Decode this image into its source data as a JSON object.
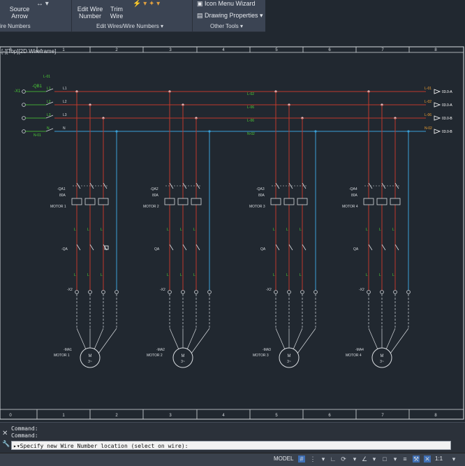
{
  "ribbon": {
    "source_arrow": "Source Arrow",
    "edit_wire_number": "Edit Wire Number",
    "trim_wire": "Trim Wire",
    "icon_menu_wizard": "Icon Menu Wizard",
    "drawing_properties": "Drawing Properties",
    "panel_wire_numbers": "ire Numbers",
    "panel_edit_wires": "Edit Wires/Wire Numbers",
    "panel_other_tools": "Other Tools"
  },
  "viewport": {
    "label": "[-][Top][2D Wireframe]"
  },
  "ruler": {
    "columns": [
      "0",
      "1",
      "2",
      "3",
      "4",
      "5",
      "6",
      "7",
      "8"
    ]
  },
  "drawing": {
    "breaker": "-QB1",
    "source_tag": "-X1",
    "feed_left": [
      "L1",
      "L2",
      "L3",
      "N"
    ],
    "feed_left_codes": [
      "L-01",
      "L-02",
      "L-03",
      "N-01"
    ],
    "bus_codes_mid": [
      "L-02",
      "L-06",
      "L-06",
      "N-02"
    ],
    "bus_outputs": [
      "L-01",
      "L-02",
      "L-06",
      "N-02"
    ],
    "bus_out_labels": [
      "03.0-A",
      "03.0-A",
      "03.0-B",
      "03.0-B"
    ],
    "motors": [
      {
        "contactor": "-QA1",
        "rating": "80A",
        "name": "MOTOR 1",
        "qa": "-QA",
        "term": "-X2",
        "motor": "-MA1"
      },
      {
        "contactor": "-QA2",
        "rating": "80A",
        "name": "MOTOR 2",
        "qa": "QA",
        "term": "-X2",
        "motor": "-MA2"
      },
      {
        "contactor": "-QA3",
        "rating": "80A",
        "name": "MOTOR 3",
        "qa": "QA",
        "term": "-X2",
        "motor": "-MA3"
      },
      {
        "contactor": "-QA4",
        "rating": "80A",
        "name": "MOTOR 4",
        "qa": "QA",
        "term": "-X2",
        "motor": "-MA4"
      }
    ],
    "motor_symbol": "M",
    "motor_phase": "3~"
  },
  "command": {
    "line1": "Command:",
    "line2": "Command:",
    "prompt": "Specify new Wire Number location (select on wire):"
  },
  "statusbar": {
    "model": "MODEL",
    "scale": "1:1"
  },
  "colors": {
    "phase": "#c0392b",
    "neutral": "#3aa0d8",
    "label_green": "#4cd137",
    "bus_label": "#f0a030"
  }
}
